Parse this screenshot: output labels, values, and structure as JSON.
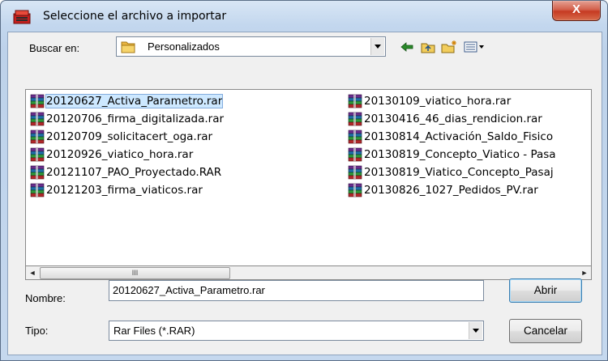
{
  "window": {
    "title": "Seleccione el archivo a importar",
    "close_label": "X",
    "app_icon": "rar-archive-icon"
  },
  "look_in": {
    "label": "Buscar en:",
    "value": "Personalizados",
    "icon": "folder-icon"
  },
  "toolbar": {
    "back_icon": "back-arrow-icon",
    "up_icon": "up-folder-icon",
    "new_folder_icon": "new-folder-icon",
    "view_menu_icon": "view-menu-icon"
  },
  "files": [
    {
      "name": "20120627_Activa_Parametro.rar",
      "selected": true
    },
    {
      "name": "20120706_firma_digitalizada.rar"
    },
    {
      "name": "20120709_solicitacert_oga.rar"
    },
    {
      "name": "20120926_viatico_hora.rar"
    },
    {
      "name": "20121107_PAO_Proyectado.RAR"
    },
    {
      "name": "20121203_firma_viaticos.rar"
    },
    {
      "name": "20130109_viatico_hora.rar"
    },
    {
      "name": "20130416_46_dias_rendicion.rar"
    },
    {
      "name": "20130814_Activación_Saldo_Fisico"
    },
    {
      "name": "20130819_Concepto_Viatico - Pasa"
    },
    {
      "name": "20130819_Viatico_Concepto_Pasaj"
    },
    {
      "name": "20130826_1027_Pedidos_PV.rar"
    }
  ],
  "scrollbar": {
    "left": "◄",
    "right": "►",
    "grip": "III"
  },
  "filename": {
    "label": "Nombre:",
    "value": "20120627_Activa_Parametro.rar"
  },
  "filetype": {
    "label": "Tipo:",
    "value": "Rar Files (*.RAR)"
  },
  "buttons": {
    "open": "Abrir",
    "cancel": "Cancelar"
  }
}
